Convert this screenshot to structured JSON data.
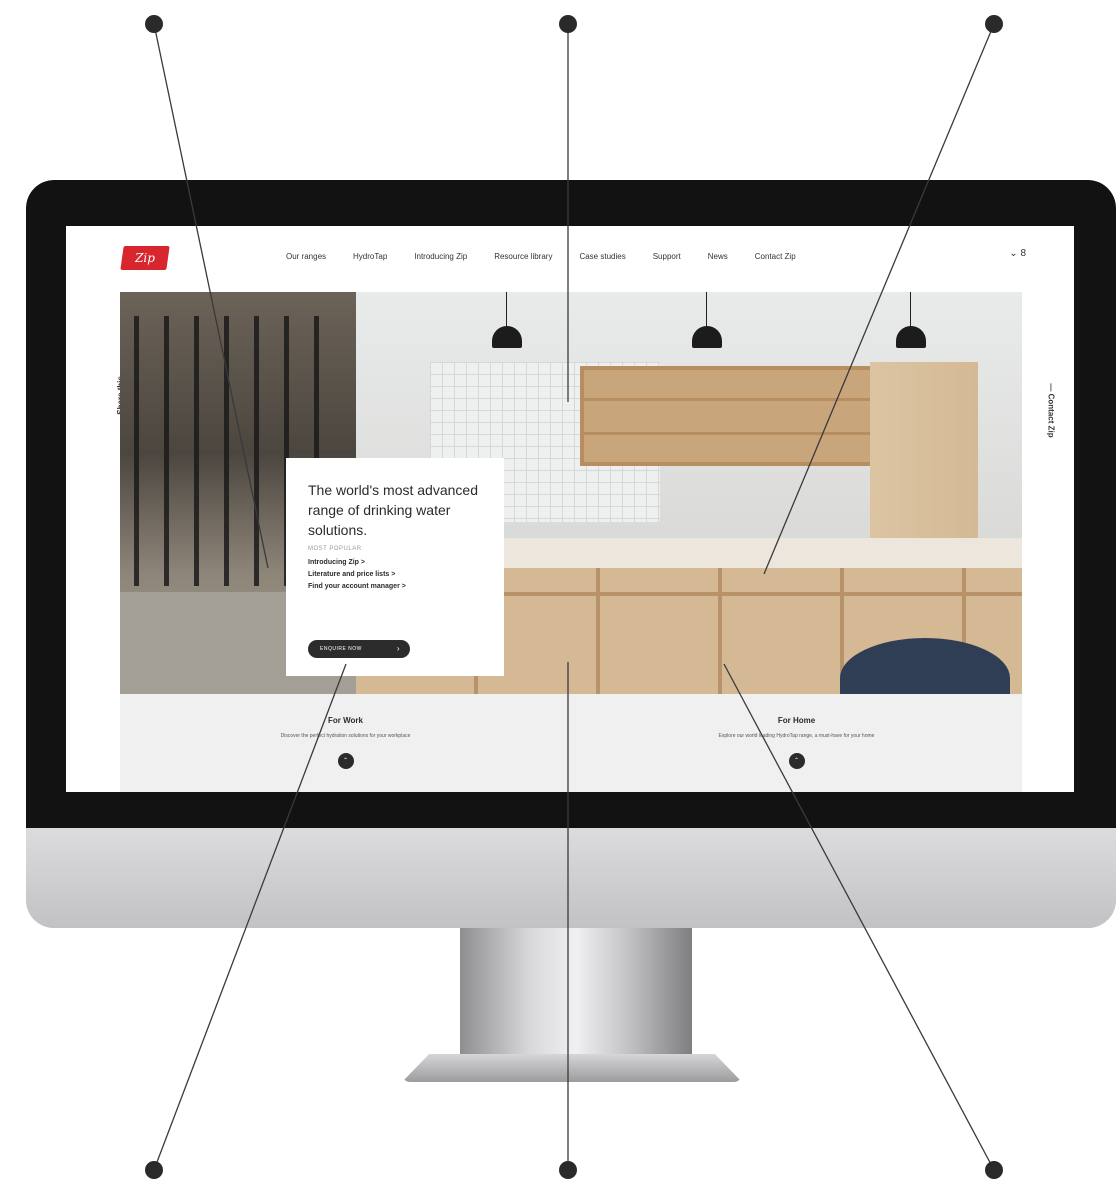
{
  "website": {
    "logo_text": "Zip",
    "nav": {
      "items": [
        "Our ranges",
        "HydroTap",
        "Introducing Zip",
        "Resource library",
        "Case studies",
        "Support",
        "News",
        "Contact Zip"
      ],
      "right_text": "⌄ 8"
    },
    "side": {
      "share": "— Share this",
      "contact": "— Contact Zip"
    },
    "hero": {
      "title": "The world's most advanced range of drinking water solutions.",
      "most_popular": "MOST POPULAR",
      "links": [
        "Introducing Zip  >",
        "Literature and price lists  >",
        "Find your account manager  >"
      ],
      "cta": "ENQUIRE NOW"
    },
    "panels": [
      {
        "title": "For Work",
        "desc": "Discover the perfect hydration solutions for your workplace"
      },
      {
        "title": "For Home",
        "desc": "Explore our world leading HydroTap range, a must-have for your home"
      }
    ]
  },
  "colors": {
    "brand": "#d8262f",
    "dark": "#2b2b2b",
    "band": "#eff0ef"
  },
  "icons": {
    "share": "share-icon",
    "contact": "contact-card-icon",
    "user": "user-icon",
    "chevron": "chevron-down-icon"
  }
}
